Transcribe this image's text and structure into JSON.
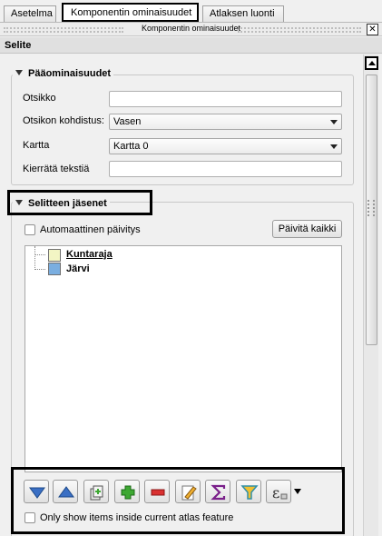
{
  "tabs": [
    {
      "label": "Asetelma",
      "active": false
    },
    {
      "label": "Komponentin ominaisuudet",
      "active": true
    },
    {
      "label": "Atlaksen luonti",
      "active": false
    }
  ],
  "dock": {
    "title": "Komponentin ominaisuudet",
    "close_glyph": "✕"
  },
  "section_header": "Selite",
  "main_props": {
    "title": "Pääominaisuudet",
    "fields": {
      "title_label": "Otsikko",
      "title_value": "",
      "alignment_label": "Otsikon kohdistus:",
      "alignment_value": "Vasen",
      "map_label": "Kartta",
      "map_value": "Kartta 0",
      "wrap_label": "Kierrätä tekstiä",
      "wrap_value": ""
    }
  },
  "legend_items": {
    "title": "Selitteen jäsenet",
    "auto_update_label": "Automaattinen päivitys",
    "auto_update_checked": false,
    "update_all_button": "Päivitä kaikki",
    "items": [
      {
        "label": "Kuntaraja",
        "color": "#f3f5c4",
        "selected": true
      },
      {
        "label": "Järvi",
        "color": "#7aaee0",
        "selected": false
      }
    ]
  },
  "toolbar": {
    "buttons": [
      {
        "name": "move-down",
        "icon": "arrow-down-icon"
      },
      {
        "name": "move-up",
        "icon": "arrow-up-icon"
      },
      {
        "name": "add-group",
        "icon": "add-group-icon"
      },
      {
        "name": "add-item",
        "icon": "plus-icon"
      },
      {
        "name": "remove-item",
        "icon": "minus-icon"
      },
      {
        "name": "edit-item",
        "icon": "edit-icon"
      },
      {
        "name": "count",
        "icon": "sigma-icon"
      },
      {
        "name": "filter",
        "icon": "filter-icon"
      },
      {
        "name": "expression",
        "icon": "expression-icon"
      }
    ],
    "atlas_only_label": "Only show items inside current atlas feature",
    "atlas_only_checked": false
  },
  "colors": {
    "highlight": "#000000",
    "arrow_blue": "#3a6fc4",
    "plus_green": "#3da832",
    "minus_red": "#d93030",
    "sigma_purple": "#7a1f8a",
    "filter_teal": "#2f8fa8"
  }
}
